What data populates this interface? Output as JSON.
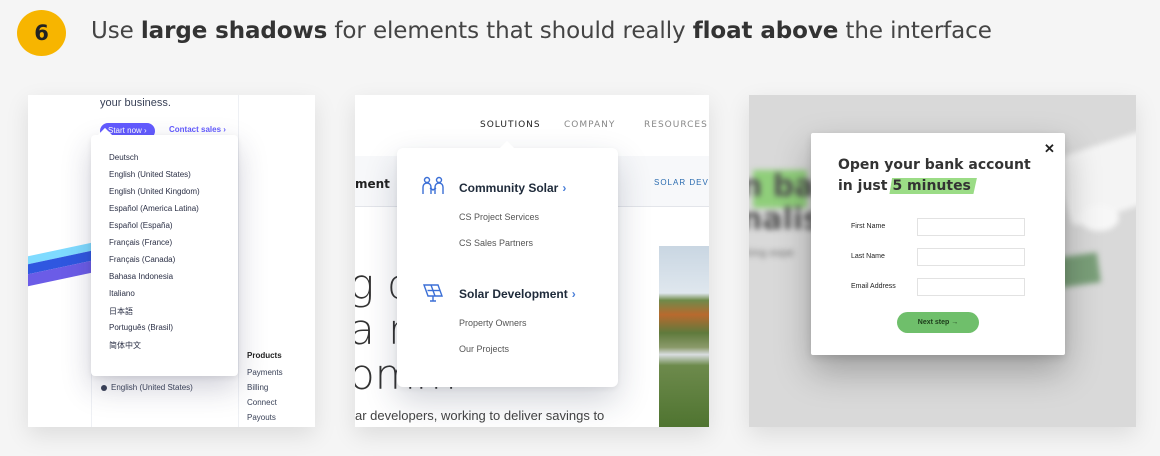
{
  "header": {
    "step_number": "6",
    "title_parts": [
      "Use ",
      "large shadows",
      " for elements that should really ",
      "float above",
      " the interface"
    ]
  },
  "panel1": {
    "business_text": "your business.",
    "start_button": "Start now ›",
    "contact_link": "Contact sales ›",
    "languages": [
      "Deutsch",
      "English (United States)",
      "English (United Kingdom)",
      "Español (America Latina)",
      "Español (España)",
      "Français (France)",
      "Français (Canada)",
      "Bahasa Indonesia",
      "Italiano",
      "日本語",
      "Português (Brasil)",
      "简体中文"
    ],
    "footer_language": "English (United States)",
    "products_heading": "Products",
    "product_links": [
      "Payments",
      "Billing",
      "Connect",
      "Payouts"
    ]
  },
  "panel2": {
    "nav": [
      "SOLUTIONS",
      "COMPANY",
      "RESOURCES"
    ],
    "subbar_title": "ment",
    "subbar_right": "SOLAR DEVEL",
    "hero_lines": [
      "g cl",
      "a r",
      "omm"
    ],
    "footer_text": "ar developers, working to deliver savings to",
    "dropdown": {
      "sections": [
        {
          "heading": "Community Solar",
          "icon": "people-icon",
          "links": [
            "CS Project Services",
            "CS Sales Partners"
          ]
        },
        {
          "heading": "Solar Development",
          "icon": "solar-panel-icon",
          "links": [
            "Property Owners",
            "Our Projects"
          ]
        }
      ]
    }
  },
  "panel3": {
    "bg_lines": [
      "n ban",
      "nalist",
      "rking expe"
    ],
    "modal": {
      "close": "✕",
      "title_line1": "Open your bank account",
      "title_line2_prefix": "in just",
      "title_highlight": "5 minutes",
      "fields": [
        "First Name",
        "Last Name",
        "Email Address"
      ],
      "button": "Next step →"
    }
  },
  "colors": {
    "badge": "#f7b500",
    "stripe_purple": "#635bff",
    "solar_blue": "#2b6cb0",
    "highlight_green": "#9bdc86",
    "button_green": "#6fbf6b"
  }
}
